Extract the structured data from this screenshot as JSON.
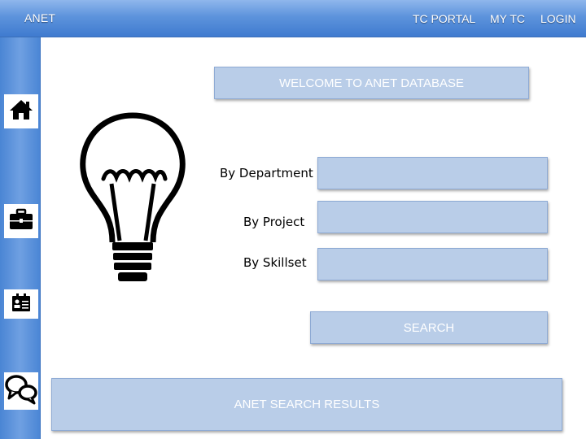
{
  "header": {
    "brand": "ANET",
    "nav": {
      "tc_portal": "TC PORTAL",
      "my_tc": "MY TC",
      "login": "LOGIN"
    }
  },
  "sidebar": {
    "items": [
      {
        "icon": "home-icon"
      },
      {
        "icon": "briefcase-icon"
      },
      {
        "icon": "id-card-icon"
      },
      {
        "icon": "chat-icon"
      }
    ]
  },
  "main": {
    "welcome": "WELCOME TO ANET DATABASE",
    "filters": {
      "department_label": "By Department",
      "project_label": "By Project",
      "skillset_label": "By Skillset",
      "department_value": "",
      "project_value": "",
      "skillset_value": ""
    },
    "search_label": "SEARCH",
    "results_label": "ANET SEARCH RESULTS"
  },
  "colors": {
    "header_blue": "#5d93dc",
    "sidebar_blue": "#6fa0e2",
    "box_fill": "#b9cde8"
  }
}
